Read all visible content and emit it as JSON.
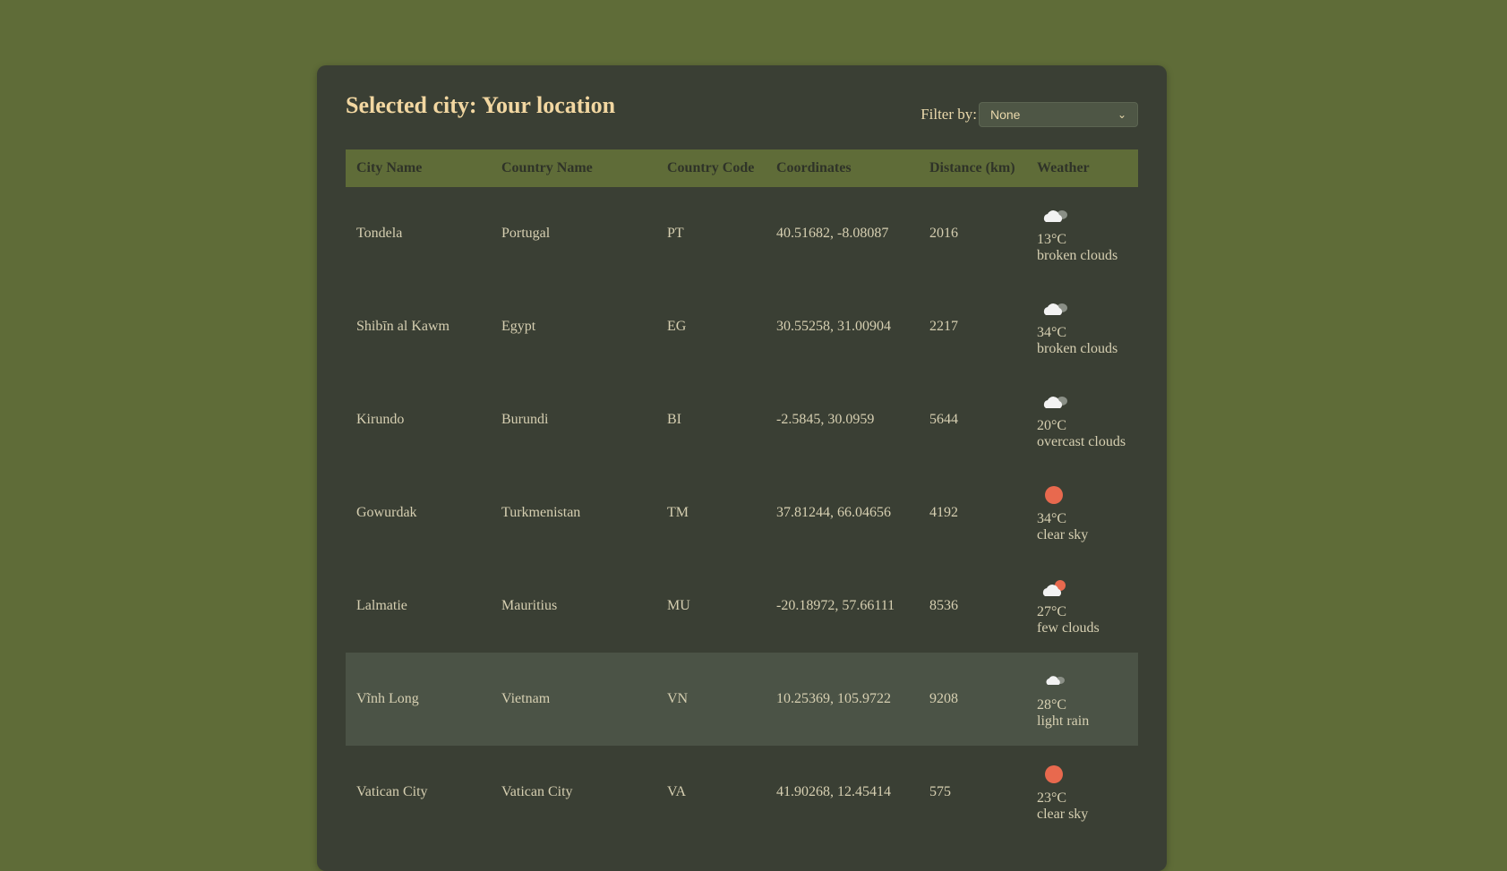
{
  "header": {
    "title": "Selected city: Your location",
    "filter_label": "Filter by:",
    "filter_value": "None"
  },
  "table": {
    "columns": [
      "City Name",
      "Country Name",
      "Country Code",
      "Coordinates",
      "Distance (km)",
      "Weather"
    ],
    "rows": [
      {
        "city": "Tondela",
        "country": "Portugal",
        "code": "PT",
        "coords": "40.51682, -8.08087",
        "distance": "2016",
        "temp": "13°C",
        "desc": "broken clouds",
        "icon": "broken-clouds-icon"
      },
      {
        "city": "Shibīn al Kawm",
        "country": "Egypt",
        "code": "EG",
        "coords": "30.55258, 31.00904",
        "distance": "2217",
        "temp": "34°C",
        "desc": "broken clouds",
        "icon": "broken-clouds-icon"
      },
      {
        "city": "Kirundo",
        "country": "Burundi",
        "code": "BI",
        "coords": "-2.5845, 30.0959",
        "distance": "5644",
        "temp": "20°C",
        "desc": "overcast clouds",
        "icon": "overcast-clouds-icon"
      },
      {
        "city": "Gowurdak",
        "country": "Turkmenistan",
        "code": "TM",
        "coords": "37.81244, 66.04656",
        "distance": "4192",
        "temp": "34°C",
        "desc": "clear sky",
        "icon": "clear-sky-icon"
      },
      {
        "city": "Lalmatie",
        "country": "Mauritius",
        "code": "MU",
        "coords": "-20.18972, 57.66111",
        "distance": "8536",
        "temp": "27°C",
        "desc": "few clouds",
        "icon": "few-clouds-icon"
      },
      {
        "city": "Vĩnh Long",
        "country": "Vietnam",
        "code": "VN",
        "coords": "10.25369, 105.9722",
        "distance": "9208",
        "temp": "28°C",
        "desc": "light rain",
        "icon": "light-rain-icon",
        "highlighted": true
      },
      {
        "city": "Vatican City",
        "country": "Vatican City",
        "code": "VA",
        "coords": "41.90268, 12.45414",
        "distance": "575",
        "temp": "23°C",
        "desc": "clear sky",
        "icon": "clear-sky-icon"
      }
    ]
  },
  "colors": {
    "background": "#5f6c38",
    "card": "#3a3f34",
    "title": "#f2d7a1",
    "sun": "#e8694e",
    "cloud": "#f2f2f2"
  }
}
